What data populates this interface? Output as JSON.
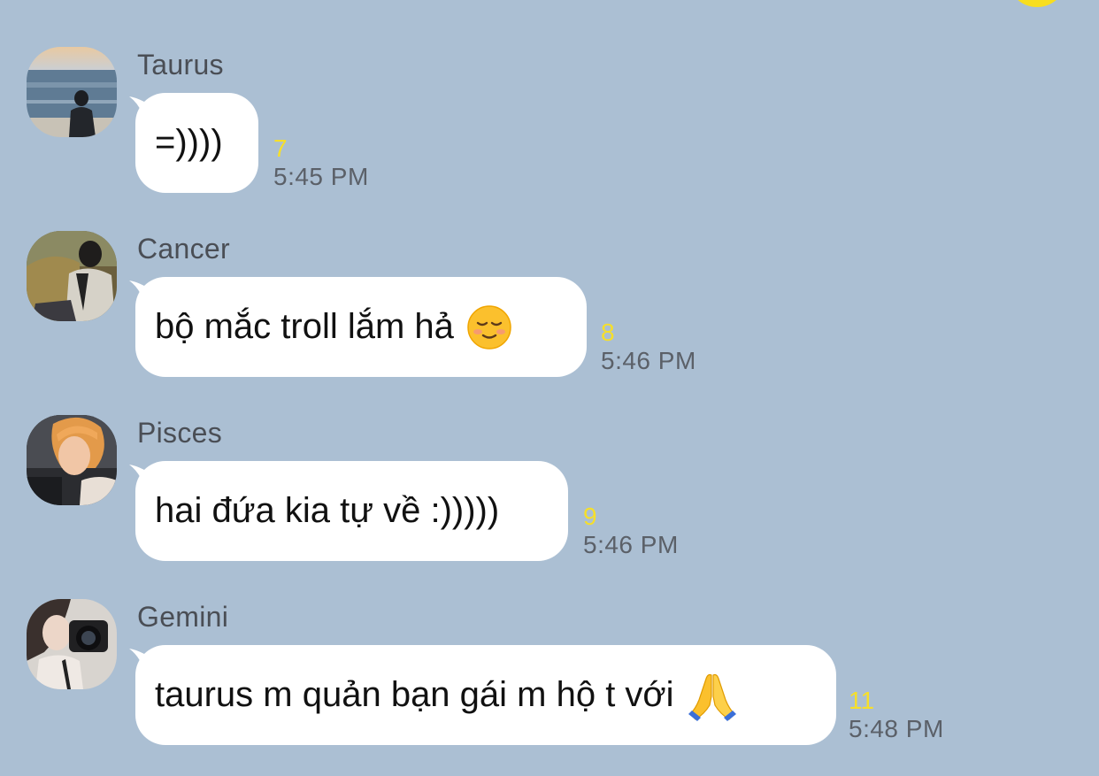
{
  "chat": {
    "messages": [
      {
        "sender": "Taurus",
        "text": "=))))",
        "emoji": "",
        "read_count": "7",
        "time": "5:45 PM"
      },
      {
        "sender": "Cancer",
        "text": "bộ mắc troll lắm hả",
        "emoji": "smiling-face-icon",
        "read_count": "8",
        "time": "5:46 PM"
      },
      {
        "sender": "Pisces",
        "text": "hai đứa kia tự về :)))))",
        "emoji": "",
        "read_count": "9",
        "time": "5:46 PM"
      },
      {
        "sender": "Gemini",
        "text": "taurus m quản bạn gái m hộ t với",
        "emoji": "folded-hands-icon",
        "read_count": "11",
        "time": "5:48 PM"
      }
    ]
  },
  "colors": {
    "background": "#abbfd3",
    "bubble": "#ffffff",
    "read_count": "#f6df2a",
    "timestamp": "#5b6068"
  }
}
